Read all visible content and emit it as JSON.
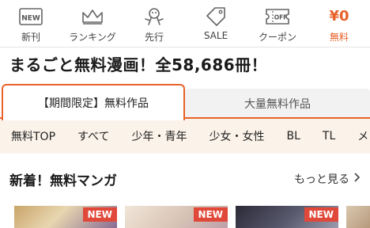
{
  "nav": {
    "items": [
      {
        "label": "新刊",
        "icon": "new-badge-icon"
      },
      {
        "label": "ランキング",
        "icon": "crown-icon"
      },
      {
        "label": "先行",
        "icon": "runner-icon"
      },
      {
        "label": "SALE",
        "icon": "tag-icon"
      },
      {
        "label": "クーポン",
        "icon": "coupon-icon"
      },
      {
        "label": "無料",
        "icon": "yen-icon",
        "value": "¥0"
      }
    ],
    "new_badge_text": "NEW",
    "coupon_text": "OFF"
  },
  "headline": "まるごと無料漫画！全58,686冊！",
  "tabs": [
    {
      "label": "【期間限定】無料作品",
      "active": true
    },
    {
      "label": "大量無料作品",
      "active": false
    }
  ],
  "categories": [
    "無料TOP",
    "すべて",
    "少年・青年",
    "少女・女性",
    "BL",
    "TL",
    "メ"
  ],
  "section": {
    "title": "新着！無料マンガ",
    "more_label": "もっと見る"
  },
  "thumbnails": [
    {
      "badge": "NEW"
    },
    {
      "badge": "NEW"
    },
    {
      "badge": "NEW"
    }
  ],
  "colors": {
    "accent": "#e8622a",
    "badge": "#e0483a",
    "category_bg": "#fbf3ea"
  }
}
